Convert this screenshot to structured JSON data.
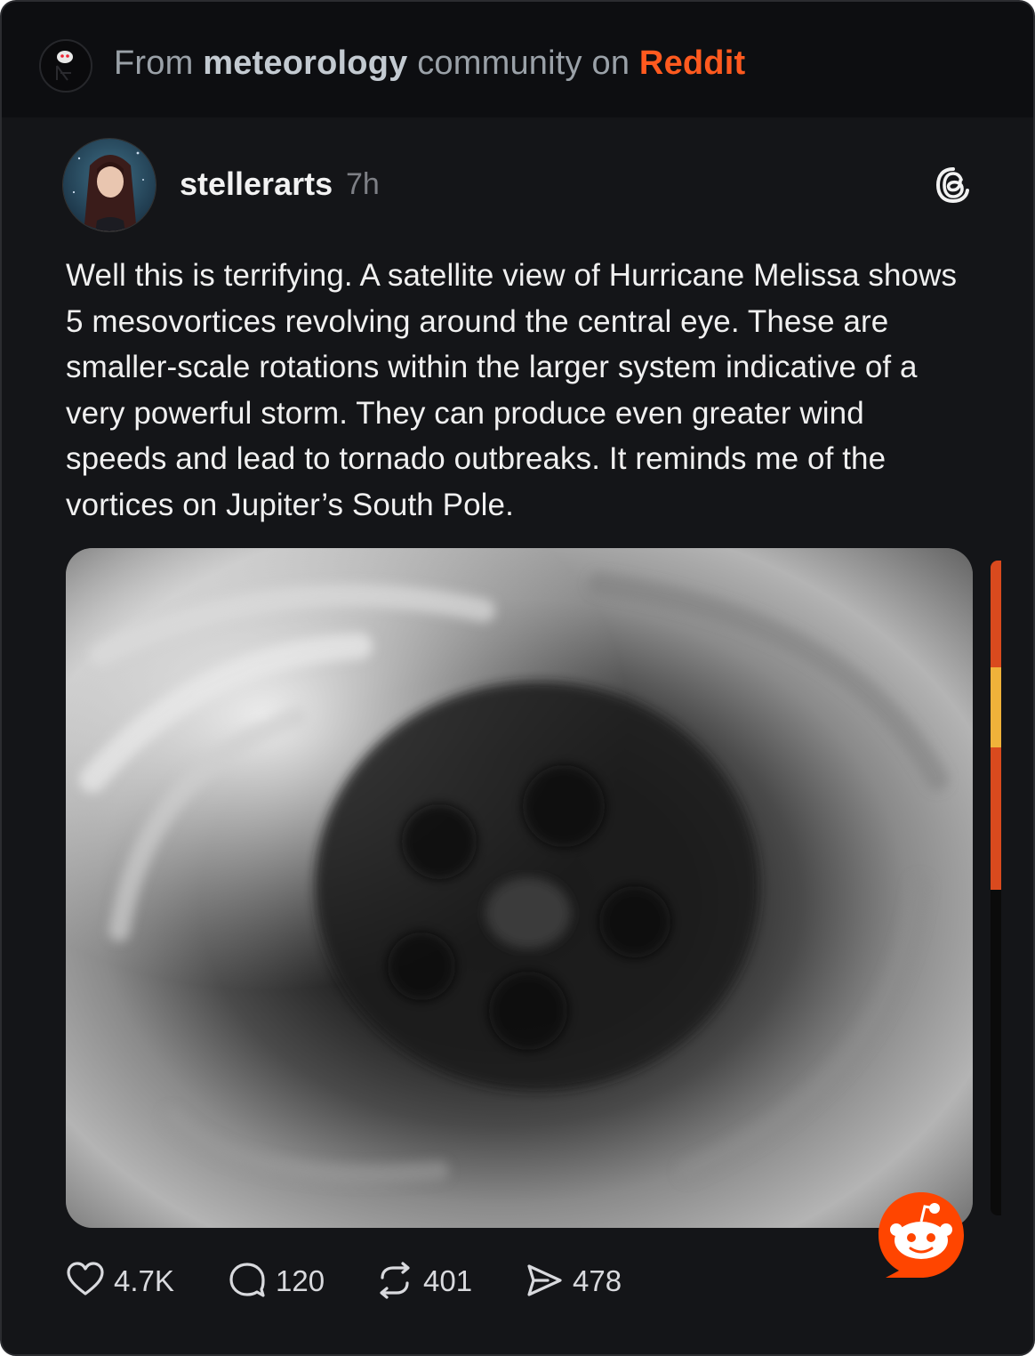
{
  "header": {
    "prefix": "From ",
    "community": "meteorology",
    "middle": " community on ",
    "brand": "Reddit",
    "brand_color": "#ff5a1f"
  },
  "post": {
    "username": "stellerarts",
    "time": "7h",
    "platform_icon": "threads-icon",
    "body": "Well this is terrifying. A satellite view of Hurricane Melissa shows 5 mesovortices revolving around the central eye. These are smaller-scale rotations within the larger system indicative of a very powerful storm. They can produce even greater wind speeds and lead to tornado outbreaks. It reminds me of the vortices on Jupiter’s South Pole."
  },
  "stats": {
    "likes": "4.7K",
    "comments": "120",
    "reposts": "401",
    "shares": "478"
  },
  "badge": {
    "icon": "reddit-snoo-icon",
    "color": "#ff4500"
  }
}
